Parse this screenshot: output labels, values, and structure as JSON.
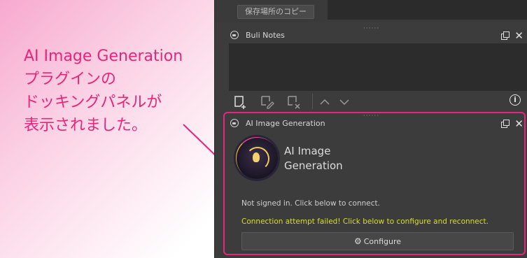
{
  "callout": {
    "lines": [
      "AI Image Generation",
      "プラグインの",
      "ドッキングパネルが",
      "表示されました。"
    ]
  },
  "top_panel": {
    "copy_button": "保存場所のコピー"
  },
  "buli_notes": {
    "title": "Buli Notes"
  },
  "ai_panel": {
    "title": "AI Image Generation",
    "name_line1": "AI Image",
    "name_line2": "Generation",
    "status": "Not signed in. Click below to connect.",
    "warning": "Connection attempt failed! Click below to configure and reconnect.",
    "configure_button": "Configure"
  },
  "colors": {
    "accent_pink": "#e8257a",
    "warning_yellow": "#d8dc3a",
    "panel_bg": "#3c3c3c"
  },
  "icons": [
    "lock-icon",
    "float-icon",
    "close-icon",
    "add-note-icon",
    "edit-note-icon",
    "delete-note-icon",
    "arrow-up-icon",
    "arrow-down-icon",
    "info-icon",
    "gear-icon",
    "ai-logo-icon"
  ]
}
